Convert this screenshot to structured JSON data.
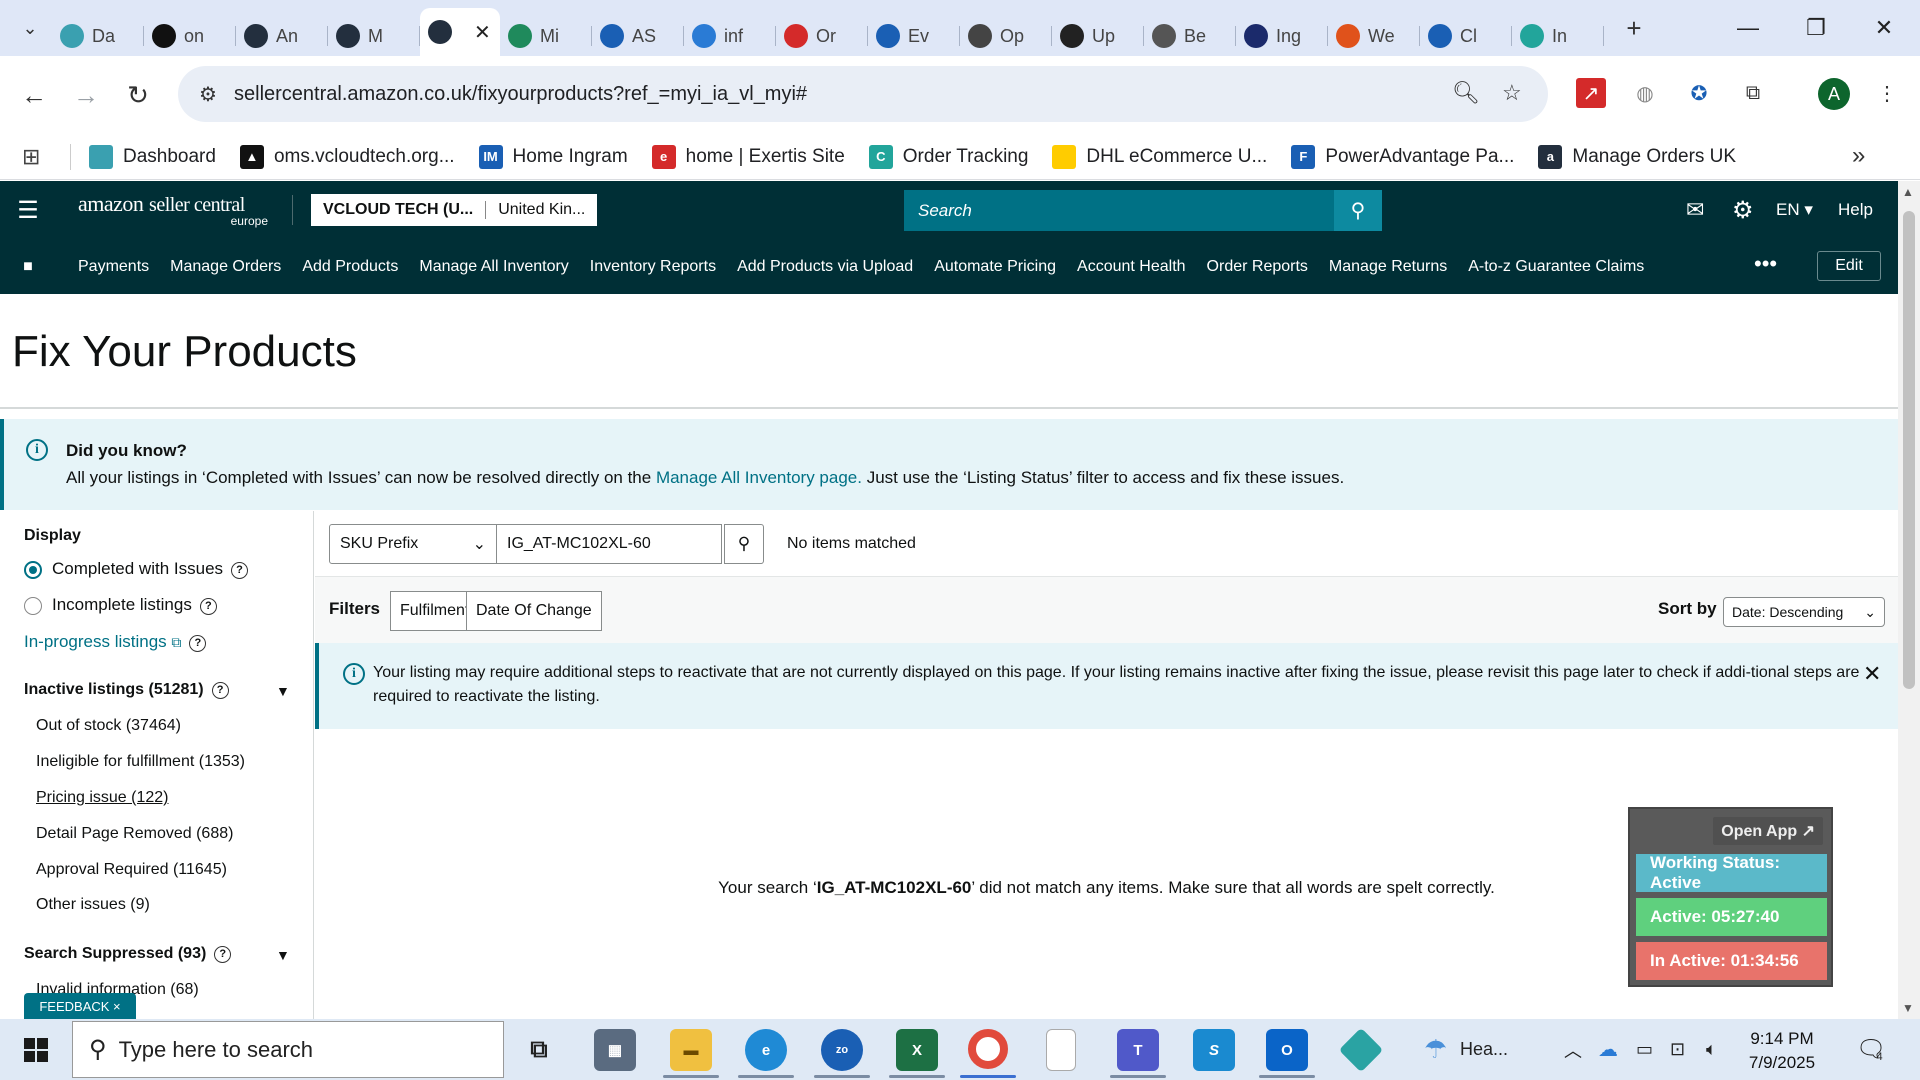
{
  "browser": {
    "tabs": [
      {
        "label": "Da",
        "color": "#3aa0b0"
      },
      {
        "label": "on",
        "color": "#111111"
      },
      {
        "label": "An",
        "color": "#232f3e"
      },
      {
        "label": "M",
        "color": "#232f3e"
      },
      {
        "label": "",
        "color": "#232f3e"
      },
      {
        "label": "Mi",
        "color": "#1f8a5c"
      },
      {
        "label": "AS",
        "color": "#1a5fb4"
      },
      {
        "label": "inf",
        "color": "#2a7bd5"
      },
      {
        "label": "Or",
        "color": "#d42a2a"
      },
      {
        "label": "Ev",
        "color": "#1a5fb4"
      },
      {
        "label": "Op",
        "color": "#444444"
      },
      {
        "label": "Up",
        "color": "#222222"
      },
      {
        "label": "Be",
        "color": "#555555"
      },
      {
        "label": "Ing",
        "color": "#1b2a6b"
      },
      {
        "label": "We",
        "color": "#e0521b"
      },
      {
        "label": "Cl",
        "color": "#1a5fb4"
      },
      {
        "label": "In",
        "color": "#22a59b"
      }
    ],
    "active_tab_close": "✕",
    "new_tab": "+",
    "url": "sellercentral.amazon.co.uk/fixyourproducts?ref_=myi_ia_vl_myi#",
    "profile_initial": "A",
    "bookmarks": [
      {
        "label": "Dashboard",
        "color": "#3aa0b0",
        "glyph": ""
      },
      {
        "label": "oms.vcloudtech.org...",
        "color": "#111111",
        "glyph": "▲"
      },
      {
        "label": "Home Ingram",
        "color": "#1a5fb4",
        "glyph": "IM"
      },
      {
        "label": "home | Exertis Site",
        "color": "#d42a2a",
        "glyph": "e"
      },
      {
        "label": "Order Tracking",
        "color": "#22a59b",
        "glyph": "C"
      },
      {
        "label": "DHL eCommerce U...",
        "color": "#ffcc00",
        "glyph": ""
      },
      {
        "label": "PowerAdvantage Pa...",
        "color": "#1a5fb4",
        "glyph": "F"
      },
      {
        "label": "Manage Orders UK",
        "color": "#232f3e",
        "glyph": "a"
      }
    ],
    "bookmarks_more": "»"
  },
  "seller_central": {
    "logo_main": "amazon",
    "logo_sub": "seller central",
    "logo_region": "europe",
    "account_name": "VCLOUD TECH (U...",
    "marketplace": "United Kin...",
    "search_placeholder": "Search",
    "language": "EN ▾",
    "help": "Help",
    "nav": [
      "Payments",
      "Manage Orders",
      "Add Products",
      "Manage All Inventory",
      "Inventory Reports",
      "Add Products via Upload",
      "Automate Pricing",
      "Account Health",
      "Order Reports",
      "Manage Returns",
      "A-to-z Guarantee Claims"
    ],
    "nav_more": "•••",
    "nav_edit": "Edit"
  },
  "page": {
    "title": "Fix Your Products",
    "did_you_know": {
      "heading": "Did you know?",
      "text_before": "All your listings in ‘Completed with Issues’ can now be resolved directly on the ",
      "link": "Manage All Inventory page.",
      "text_after": " Just use the ‘Listing Status’ filter to access and fix these issues."
    },
    "sidebar": {
      "display_heading": "Display",
      "options": [
        {
          "label": "Completed with Issues",
          "selected": true
        },
        {
          "label": "Incomplete listings",
          "selected": false
        }
      ],
      "in_progress_link": "In-progress listings",
      "inactive": {
        "heading": "Inactive listings (51281)",
        "items": [
          "Out of stock (37464)",
          "Ineligible for fulfillment (1353)",
          "Pricing issue (122)",
          "Detail Page Removed (688)",
          "Approval Required (11645)",
          "Other issues (9)"
        ]
      },
      "suppressed": {
        "heading": "Search Suppressed (93)",
        "items": [
          "Invalid information (68)"
        ]
      },
      "feedback": "FEEDBACK ×"
    },
    "search": {
      "filter_type": "SKU Prefix",
      "query": "IG_AT-MC102XL-60",
      "result_status": "No items matched"
    },
    "filters": {
      "label": "Filters",
      "buttons": [
        "Fulfilment",
        "Date Of Change"
      ],
      "sort_label": "Sort by",
      "sort_value": "Date: Descending"
    },
    "notice": "Your listing may require additional steps to reactivate that are not currently displayed on this page. If your listing remains inactive after fixing the issue, please revisit this page later to check if addi-tional steps are required to reactivate the listing.",
    "no_result": {
      "before": "Your search ‘",
      "query": "IG_AT-MC102XL-60",
      "after": "’ did not match any items. Make sure that all words are spelt correctly."
    }
  },
  "widget": {
    "open_app": "Open App ↗",
    "status": "Working Status: Active",
    "active": "Active: 05:27:40",
    "inactive": "In Active: 01:34:56",
    "colors": {
      "status": "#5bb9c9",
      "active": "#5fd07e",
      "inactive": "#e8736b"
    }
  },
  "taskbar": {
    "search_placeholder": "Type here to search",
    "weather": "Hea...",
    "time": "9:14 PM",
    "date": "7/9/2025",
    "notification_count": "4"
  }
}
